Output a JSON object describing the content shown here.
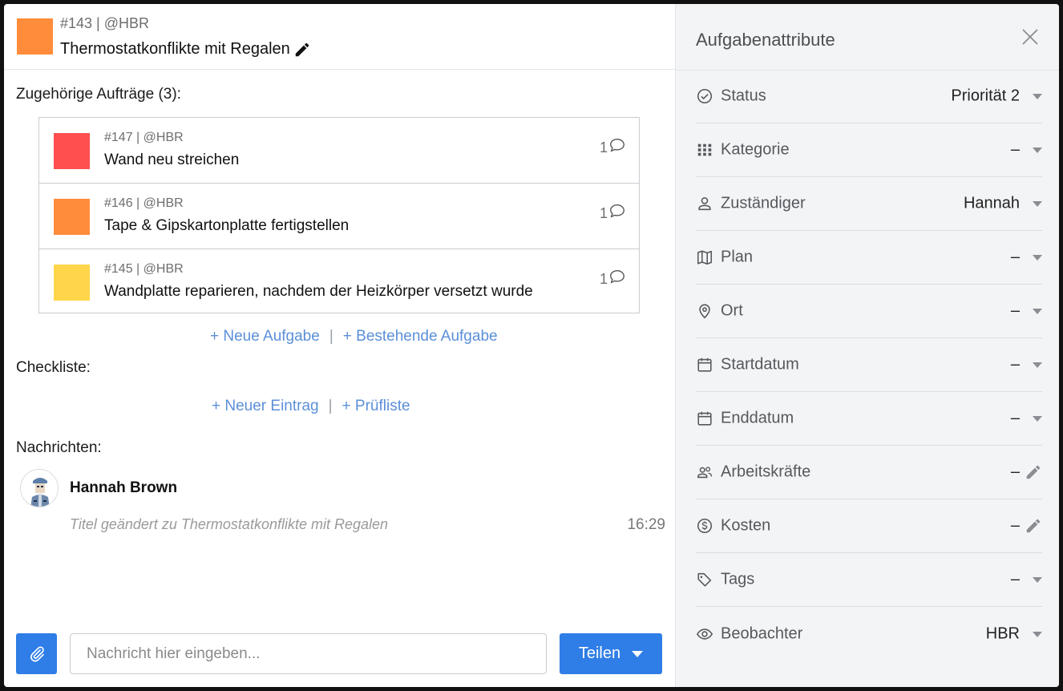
{
  "task": {
    "meta": "#143 | @HBR",
    "title": "Thermostatkonflikte mit Regalen",
    "color": "#ff8c3a"
  },
  "related": {
    "label": "Zugehörige Aufträge (3):",
    "items": [
      {
        "meta": "#147 | @HBR",
        "title": "Wand neu streichen",
        "comments": "1",
        "color": "#ff4f4f"
      },
      {
        "meta": "#146 | @HBR",
        "title": "Tape & Gipskartonplatte fertigstellen",
        "comments": "1",
        "color": "#ff8c3a"
      },
      {
        "meta": "#145 | @HBR",
        "title": "Wandplatte reparieren, nachdem der Heizkörper versetzt wurde",
        "comments": "1",
        "color": "#ffd54a"
      }
    ],
    "new_task": "+ Neue Aufgabe",
    "existing_task": "+ Bestehende Aufgabe",
    "separator": "|"
  },
  "checklist": {
    "label": "Checkliste:",
    "new_entry": "+ Neuer Eintrag",
    "checklist": "+ Prüfliste",
    "separator": "|"
  },
  "messages": {
    "label": "Nachrichten:",
    "items": [
      {
        "author": "Hannah Brown",
        "text": "Titel geändert zu Thermostatkonflikte mit Regalen",
        "time": "16:29"
      }
    ]
  },
  "composer": {
    "placeholder": "Nachricht hier eingeben...",
    "share_label": "Teilen"
  },
  "sidebar": {
    "title": "Aufgabenattribute",
    "attributes": [
      {
        "label": "Status",
        "value": "Priorität 2",
        "icon": "check-circle-icon",
        "control": "dropdown"
      },
      {
        "label": "Kategorie",
        "value": "–",
        "icon": "grid-icon",
        "control": "dropdown"
      },
      {
        "label": "Zuständiger",
        "value": "Hannah",
        "icon": "person-icon",
        "control": "dropdown"
      },
      {
        "label": "Plan",
        "value": "–",
        "icon": "map-icon",
        "control": "dropdown"
      },
      {
        "label": "Ort",
        "value": "–",
        "icon": "location-pin-icon",
        "control": "dropdown"
      },
      {
        "label": "Startdatum",
        "value": "–",
        "icon": "calendar-icon",
        "control": "dropdown"
      },
      {
        "label": "Enddatum",
        "value": "–",
        "icon": "calendar-icon",
        "control": "dropdown"
      },
      {
        "label": "Arbeitskräfte",
        "value": "–",
        "icon": "people-icon",
        "control": "edit"
      },
      {
        "label": "Kosten",
        "value": "–",
        "icon": "dollar-circle-icon",
        "control": "edit"
      },
      {
        "label": "Tags",
        "value": "–",
        "icon": "tag-icon",
        "control": "dropdown"
      },
      {
        "label": "Beobachter",
        "value": "HBR",
        "icon": "eye-icon",
        "control": "dropdown"
      }
    ]
  },
  "colors": {
    "accent": "#2f7de6",
    "link": "#5b8fd8"
  }
}
